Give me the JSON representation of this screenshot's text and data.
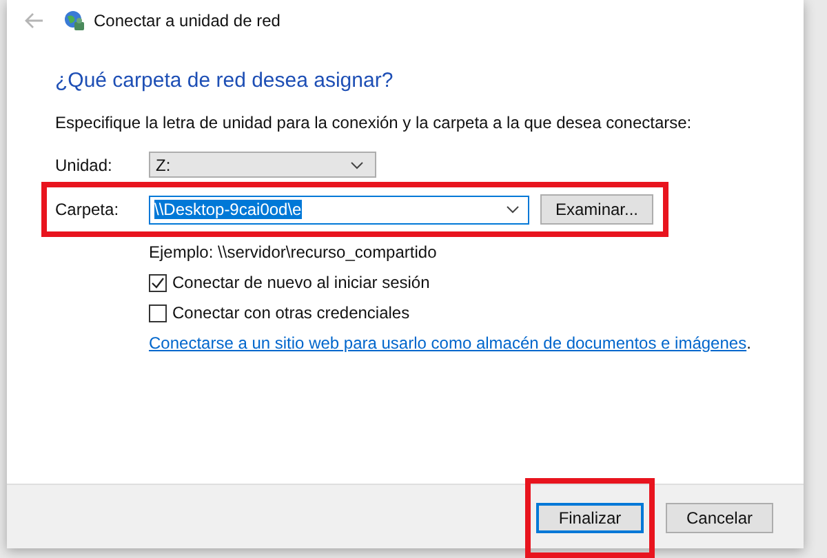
{
  "window": {
    "title": "Conectar a unidad de red"
  },
  "heading": "¿Qué carpeta de red desea asignar?",
  "instruction": "Especifique la letra de unidad para la conexión y la carpeta a la que desea conectarse:",
  "drive": {
    "label": "Unidad:",
    "value": "Z:"
  },
  "folder": {
    "label": "Carpeta:",
    "value": "\\\\Desktop-9cai0od\\e",
    "text_selected": true,
    "annotated": true,
    "browse_button": "Examinar..."
  },
  "example": "Ejemplo: \\\\servidor\\recurso_compartido",
  "options": [
    {
      "label": "Conectar de nuevo al iniciar sesión",
      "checked": true
    },
    {
      "label": "Conectar con otras credenciales",
      "checked": false
    }
  ],
  "link": "Conectarse a un sitio web para usarlo como almacén de documentos e imágenes",
  "link_suffix": ".",
  "buttons": [
    {
      "label": "Finalizar",
      "default": true,
      "annotated": true
    },
    {
      "label": "Cancelar",
      "default": false,
      "annotated": false
    }
  ]
}
